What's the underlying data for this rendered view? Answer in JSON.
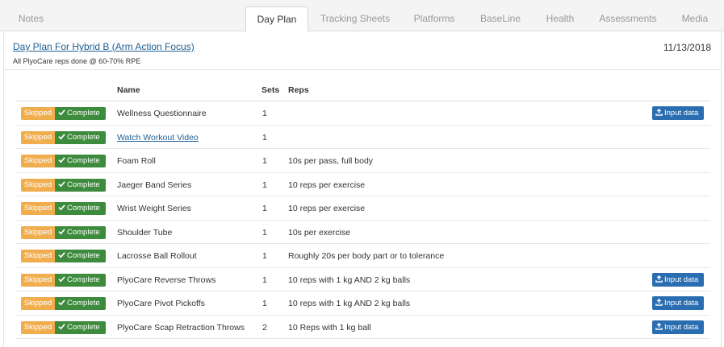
{
  "tabs": [
    {
      "label": "Notes",
      "active": false
    },
    {
      "label": "Day Plan",
      "active": true
    },
    {
      "label": "Tracking Sheets",
      "active": false
    },
    {
      "label": "Platforms",
      "active": false
    },
    {
      "label": "BaseLine",
      "active": false
    },
    {
      "label": "Health",
      "active": false
    },
    {
      "label": "Assessments",
      "active": false
    },
    {
      "label": "Media",
      "active": false
    }
  ],
  "plan": {
    "title": "Day Plan For Hybrid B (Arm Action Focus)",
    "subtitle": "All PlyoCare reps done @ 60-70% RPE",
    "date": "11/13/2018"
  },
  "table": {
    "headers": {
      "name": "Name",
      "sets": "Sets",
      "reps": "Reps"
    },
    "skipped_label": "Skipped",
    "complete_label": "Complete",
    "input_label": "Input data",
    "rows": [
      {
        "name": "Wellness Questionnaire",
        "sets": "1",
        "reps": "",
        "link": false,
        "input": true
      },
      {
        "name": "Watch Workout Video",
        "sets": "1",
        "reps": "",
        "link": true,
        "input": false
      },
      {
        "name": "Foam Roll",
        "sets": "1",
        "reps": "10s per pass, full body",
        "link": false,
        "input": false
      },
      {
        "name": "Jaeger Band Series",
        "sets": "1",
        "reps": "10 reps per exercise",
        "link": false,
        "input": false
      },
      {
        "name": "Wrist Weight Series",
        "sets": "1",
        "reps": "10 reps per exercise",
        "link": false,
        "input": false
      },
      {
        "name": "Shoulder Tube",
        "sets": "1",
        "reps": "10s per exercise",
        "link": false,
        "input": false
      },
      {
        "name": "Lacrosse Ball Rollout",
        "sets": "1",
        "reps": "Roughly 20s per body part or to tolerance",
        "link": false,
        "input": false
      },
      {
        "name": "PlyoCare Reverse Throws",
        "sets": "1",
        "reps": "10 reps with 1 kg AND 2 kg balls",
        "link": false,
        "input": true
      },
      {
        "name": "PlyoCare Pivot Pickoffs",
        "sets": "1",
        "reps": "10 reps with 1 kg AND 2 kg balls",
        "link": false,
        "input": true
      },
      {
        "name": "PlyoCare Scap Retraction Throws",
        "sets": "2",
        "reps": "10 Reps with 1 kg ball",
        "link": false,
        "input": true
      }
    ]
  },
  "colors": {
    "skipped": "#f0ad4e",
    "complete": "#3d8b3d",
    "input": "#2a6db1",
    "link": "#1f5f94"
  },
  "icons": {
    "complete": "check-icon",
    "input": "upload-icon"
  }
}
